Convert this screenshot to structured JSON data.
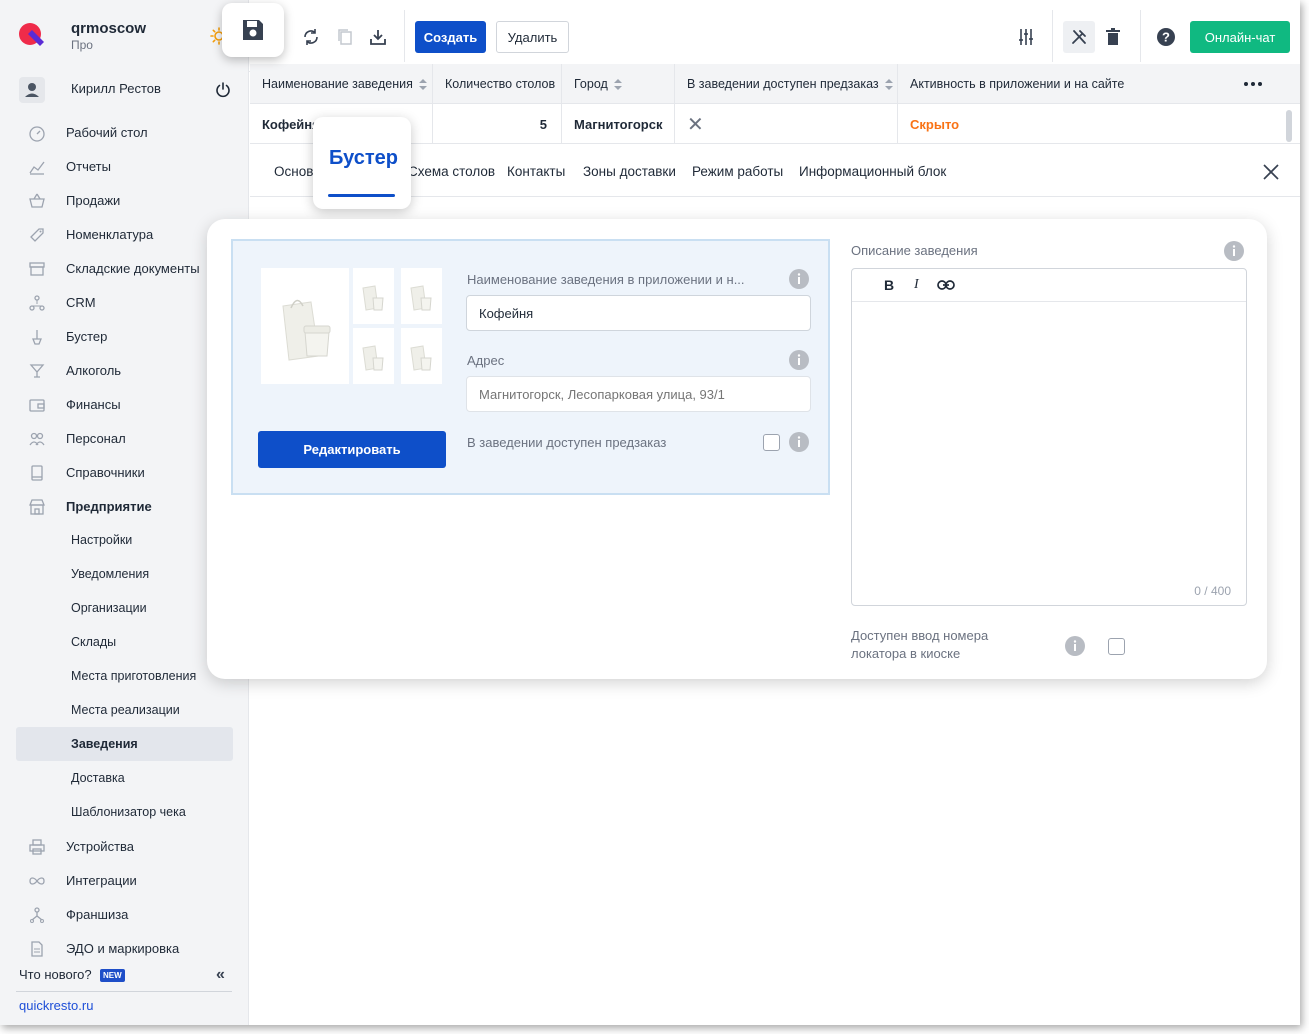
{
  "brand": {
    "name": "qrmoscow",
    "plan": "Про"
  },
  "user": {
    "name": "Кирилл Рестов"
  },
  "sidebar": {
    "items": [
      {
        "label": "Рабочий стол",
        "icon": "dashboard-icon"
      },
      {
        "label": "Отчеты",
        "icon": "reports-icon"
      },
      {
        "label": "Продажи",
        "icon": "basket-icon"
      },
      {
        "label": "Номенклатура",
        "icon": "tag-icon"
      },
      {
        "label": "Складские документы",
        "icon": "warehouse-icon"
      },
      {
        "label": "CRM",
        "icon": "crm-icon"
      },
      {
        "label": "Бустер",
        "icon": "booster-icon"
      },
      {
        "label": "Алкоголь",
        "icon": "glass-icon"
      },
      {
        "label": "Финансы",
        "icon": "wallet-icon"
      },
      {
        "label": "Персонал",
        "icon": "people-icon"
      },
      {
        "label": "Справочники",
        "icon": "book-icon"
      },
      {
        "label": "Предприятие",
        "icon": "store-icon"
      }
    ],
    "subitems": [
      {
        "label": "Настройки"
      },
      {
        "label": "Уведомления"
      },
      {
        "label": "Организации"
      },
      {
        "label": "Склады"
      },
      {
        "label": "Места приготовления"
      },
      {
        "label": "Места реализации"
      },
      {
        "label": "Заведения"
      },
      {
        "label": "Доставка"
      },
      {
        "label": "Шаблонизатор чека"
      }
    ],
    "items_bottom": [
      {
        "label": "Устройства",
        "icon": "printer-icon"
      },
      {
        "label": "Интеграции",
        "icon": "infinity-icon"
      },
      {
        "label": "Франшиза",
        "icon": "franchise-icon"
      },
      {
        "label": "ЭДО и маркировка",
        "icon": "document-icon"
      }
    ],
    "whats_new": "Что нового?",
    "badge": "NEW",
    "site_link": "quickresto.ru"
  },
  "toolbar": {
    "create_label": "Создать",
    "delete_label": "Удалить",
    "chat_label": "Онлайн-чат"
  },
  "table": {
    "columns": [
      "Наименование заведения",
      "Количество столов",
      "Город",
      "В заведении доступен предзаказ",
      "Активность в приложении и на сайте"
    ],
    "row": {
      "name": "Кофейня",
      "tables": "5",
      "city": "Магнитогорск",
      "preorder": "✕",
      "activity": "Скрыто"
    }
  },
  "tabs": {
    "items": [
      "Основ",
      "Схема столов",
      "Контакты",
      "Зоны доставки",
      "Режим работы",
      "Информационный блок"
    ],
    "active": "Бустер"
  },
  "form": {
    "name_label": "Наименование заведения в приложении и н...",
    "name_value": "Кофейня",
    "address_label": "Адрес",
    "address_placeholder": "Магнитогорск, Лесопарковая улица, 93/1",
    "preorder_label": "В заведении доступен предзаказ",
    "edit_label": "Редактировать",
    "description_label": "Описание заведения",
    "counter": "0 / 400",
    "kiosk_label": "Доступен ввод номера локатора в киоске"
  },
  "colors": {
    "primary": "#0e4fc9",
    "chat": "#10b981",
    "status_hidden": "#f97316"
  }
}
